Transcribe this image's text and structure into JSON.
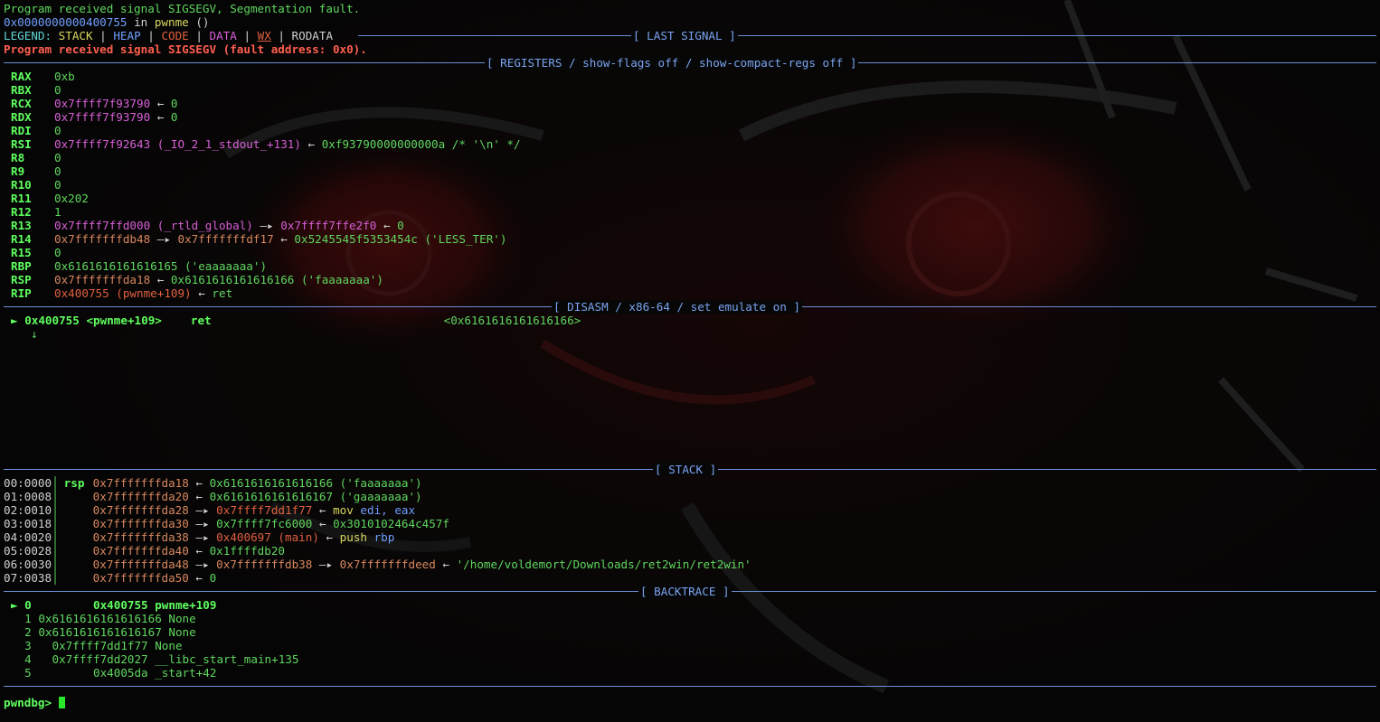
{
  "top": {
    "line1": "Program received signal SIGSEGV, Segmentation fault.",
    "addr": "0x0000000000400755",
    "in": " in ",
    "func": "pwnme",
    "paren": " ()",
    "legend_prefix": "LEGEND: ",
    "legend": {
      "stack": "STACK",
      "heap": "HEAP",
      "code": "CODE",
      "data": "DATA",
      "wx": "WX",
      "rodata": "RODATA",
      "sep": " | "
    }
  },
  "sections": {
    "last_signal": "[ LAST SIGNAL ]",
    "registers": "[ REGISTERS / show-flags off / show-compact-regs off ]",
    "disasm": "[ DISASM / x86-64 / set emulate on ]",
    "stack": "[ STACK ]",
    "backtrace": "[ BACKTRACE ]"
  },
  "last_signal": "Program received signal SIGSEGV (fault address: 0x0).",
  "registers": {
    "rax": {
      "name": "RAX",
      "v": "0xb"
    },
    "rbx": {
      "name": "RBX",
      "v": "0"
    },
    "rcx": {
      "name": "RCX",
      "v": "0x7ffff7f93790",
      "arrow": " ← ",
      "t": "0"
    },
    "rdx": {
      "name": "RDX",
      "v": "0x7ffff7f93790",
      "arrow": " ← ",
      "t": "0"
    },
    "rdi": {
      "name": "RDI",
      "v": "0"
    },
    "rsi": {
      "name": "RSI",
      "v": "0x7ffff7f92643 (_IO_2_1_stdout_+131)",
      "arrow": " ← ",
      "t": "0xf93790000000000a /* '\\n' */"
    },
    "r8": {
      "name": "R8",
      "v": "0"
    },
    "r9": {
      "name": "R9",
      "v": "0"
    },
    "r10": {
      "name": "R10",
      "v": "0"
    },
    "r11": {
      "name": "R11",
      "v": "0x202"
    },
    "r12": {
      "name": "R12",
      "v": "1"
    },
    "r13": {
      "name": "R13",
      "v": "0x7ffff7ffd000 (_rtld_global)",
      "arrow": " —▸ ",
      "t": "0x7ffff7ffe2f0",
      "arrow2": " ← ",
      "t2": "0"
    },
    "r14": {
      "name": "R14",
      "v": "0x7fffffffdb48",
      "arrow": " —▸ ",
      "t": "0x7fffffffdf17",
      "arrow2": " ← ",
      "t2": "0x5245545f5353454c ('LESS_TER')"
    },
    "r15": {
      "name": "R15",
      "v": "0"
    },
    "rbp": {
      "name": "RBP",
      "v": "0x6161616161616165 ('eaaaaaaa')"
    },
    "rsp": {
      "name": "RSP",
      "v": "0x7fffffffda18",
      "arrow": " ← ",
      "t": "0x6161616161616166 ('faaaaaaa')"
    },
    "rip": {
      "name": "RIP",
      "v": "0x400755 (pwnme+109)",
      "arrow": " ← ",
      "t": "ret"
    }
  },
  "disasm": {
    "marker": "►",
    "addr": "0x400755",
    "sym": "<pwnme+109>",
    "mnem": "ret",
    "target": "<0x6161616161616166>",
    "down": "↓"
  },
  "stack": [
    {
      "idx": "00:0000",
      "reg": "rsp",
      "addr": "0x7fffffffda18",
      "arrow": " ← ",
      "rest": "0x6161616161616166 ('faaaaaaa')"
    },
    {
      "idx": "01:0008",
      "reg": "",
      "addr": "0x7fffffffda20",
      "arrow": " ← ",
      "rest": "0x6161616161616167 ('gaaaaaaa')"
    },
    {
      "idx": "02:0010",
      "reg": "",
      "addr": "0x7fffffffda28",
      "arrow": " —▸ ",
      "ptr": "0x7ffff7dd1f77",
      "arrow2": " ← ",
      "ins": "mov ",
      "ops": "edi, eax"
    },
    {
      "idx": "03:0018",
      "reg": "",
      "addr": "0x7fffffffda30",
      "arrow": " —▸ ",
      "ptr": "0x7ffff7fc6000",
      "arrow2": " ← ",
      "rest2": "0x3010102464c457f"
    },
    {
      "idx": "04:0020",
      "reg": "",
      "addr": "0x7fffffffda38",
      "arrow": " —▸ ",
      "ptr": "0x400697 (main)",
      "arrow2": " ← ",
      "ins": "push ",
      "ops": "rbp"
    },
    {
      "idx": "05:0028",
      "reg": "",
      "addr": "0x7fffffffda40",
      "arrow": " ← ",
      "rest": "0x1ffffdb20"
    },
    {
      "idx": "06:0030",
      "reg": "",
      "addr": "0x7fffffffda48",
      "arrow": " —▸ ",
      "ptr": "0x7fffffffdb38",
      "arrow2": " —▸ ",
      "ptr2": "0x7fffffffdeed",
      "arrow3": " ← ",
      "rest3": "'/home/voldemort/Downloads/ret2win/ret2win'"
    },
    {
      "idx": "07:0038",
      "reg": "",
      "addr": "0x7fffffffda50",
      "arrow": " ← ",
      "rest": "0"
    }
  ],
  "backtrace": [
    {
      "line": "► 0         0x400755 pwnme+109"
    },
    {
      "line": "  1 0x6161616161616166 None"
    },
    {
      "line": "  2 0x6161616161616167 None"
    },
    {
      "line": "  3   0x7ffff7dd1f77 None"
    },
    {
      "line": "  4   0x7ffff7dd2027 __libc_start_main+135"
    },
    {
      "line": "  5         0x4005da _start+42"
    }
  ],
  "prompt": "pwndbg> ",
  "colors": {
    "header": "#7aa3f0",
    "rule": "#6a8fd6",
    "green": "#5fd75f",
    "magenta": "#d75fd7",
    "red": "#e06040",
    "cursor": "#29e629"
  }
}
